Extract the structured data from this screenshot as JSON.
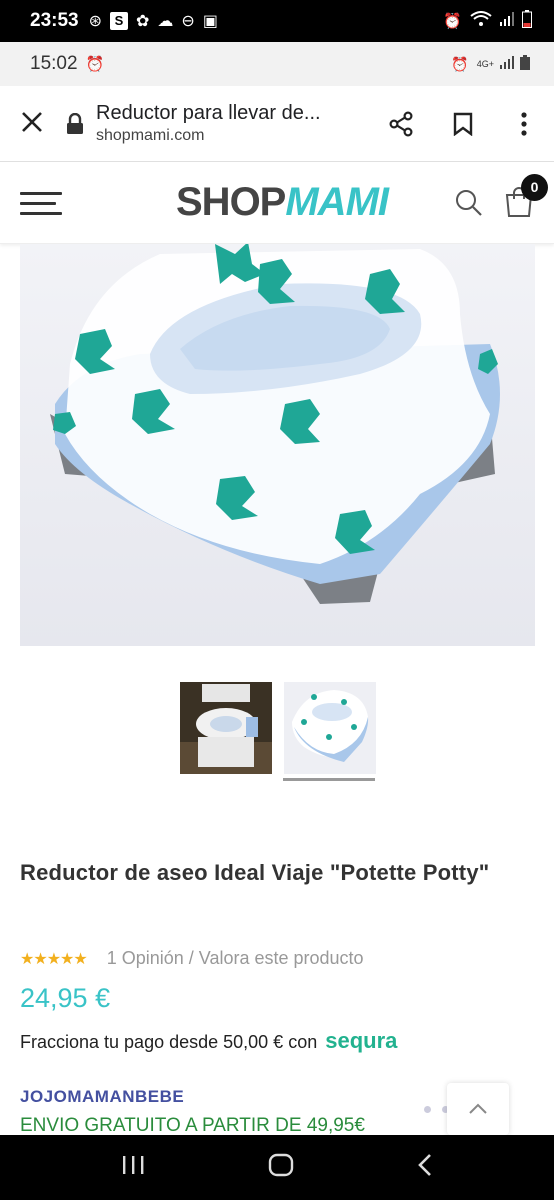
{
  "system_status": {
    "time": "23:53"
  },
  "browser_status": {
    "time": "15:02",
    "network": "4G+"
  },
  "url_bar": {
    "page_title": "Reductor para llevar de...",
    "domain": "shopmami.com"
  },
  "shop_header": {
    "logo_part1": "SHOP",
    "logo_part2": "MAMI",
    "cart_count": "0"
  },
  "product": {
    "title": "Reductor de aseo Ideal Viaje \"Potette Potty\"",
    "rating_stars": "★★★★★",
    "rating_text": "1 Opinión / Valora este producto",
    "price": "24,95 €",
    "financing_text": "Fracciona tu pago desde 50,00 € con",
    "financing_brand": "sequra",
    "brand": "JOJOMAMANBEBE",
    "shipping_text": "ENVIO GRATUITO A PARTIR DE 49,95€"
  },
  "colors": {
    "accent": "#39c3c7",
    "brand_link": "#4450a0",
    "shipping": "#2a8c3c",
    "stars": "#f2b01e"
  }
}
